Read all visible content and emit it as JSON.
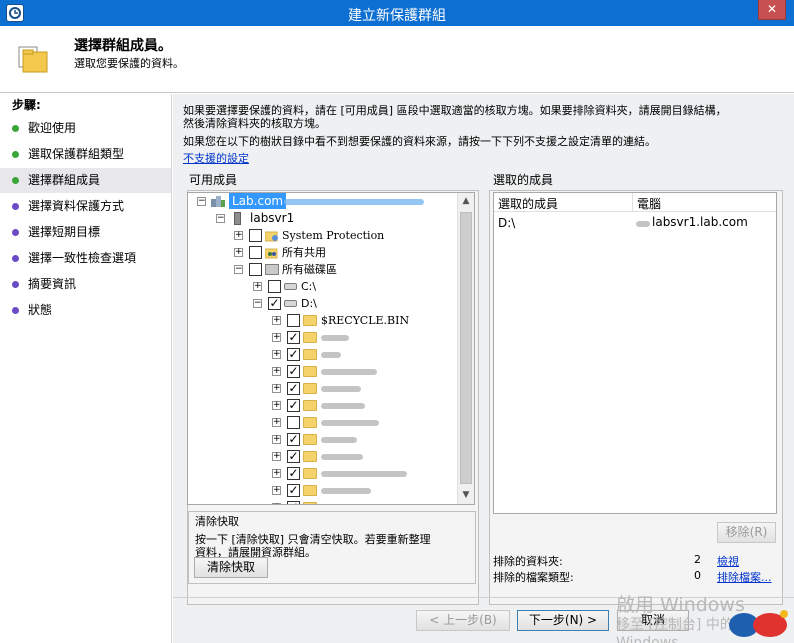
{
  "window": {
    "title": "建立新保護群組",
    "close": "✕"
  },
  "header": {
    "title": "選擇群組成員。",
    "subtitle": "選取您要保護的資料。"
  },
  "steps": {
    "title": "步驟:",
    "items": [
      {
        "label": "歡迎使用",
        "color": "#3aa63a"
      },
      {
        "label": "選取保護群組類型",
        "color": "#3aa63a"
      },
      {
        "label": "選擇群組成員",
        "color": "#3aa63a"
      },
      {
        "label": "選擇資料保護方式",
        "color": "#6a4bc4"
      },
      {
        "label": "選擇短期目標",
        "color": "#6a4bc4"
      },
      {
        "label": "選擇一致性檢查選項",
        "color": "#6a4bc4"
      },
      {
        "label": "摘要資訊",
        "color": "#6a4bc4"
      },
      {
        "label": "狀態",
        "color": "#6a4bc4"
      }
    ]
  },
  "intro": {
    "line1": "如果要選擇要保護的資料，請在 [可用成員] 區段中選取適當的核取方塊。如果要排除資料夾，請展開目錄結構，",
    "line2": "然後清除資料夾的核取方塊。",
    "line3": "如果您在以下的樹狀目錄中看不到想要保護的資料來源，請按一下下列不支援之設定清單的連結。",
    "unsupported_link": "不支援的設定"
  },
  "available": {
    "label": "可用成員",
    "tree": {
      "domain": "Lab.com",
      "server": "labsvr1",
      "system_protection": "System Protection",
      "all_shares": "所有共用",
      "all_volumes": "所有磁碟區",
      "drive_c": "C:\\",
      "drive_d": "D:\\",
      "recycle": "$RECYCLE.BIN",
      "folders": [
        {
          "checked": true
        },
        {
          "checked": true
        },
        {
          "checked": true
        },
        {
          "checked": true
        },
        {
          "checked": true
        },
        {
          "checked": false
        },
        {
          "checked": true
        },
        {
          "checked": true
        },
        {
          "checked": true
        },
        {
          "checked": true
        },
        {
          "checked": true
        }
      ]
    }
  },
  "cache": {
    "title": "清除快取",
    "desc1": "按一下 [清除快取] 只會清空快取。若要重新整理",
    "desc2": "資料，請展開資源群組。",
    "button": "清除快取"
  },
  "selected": {
    "label": "選取的成員",
    "columns": [
      "選取的成員",
      "電腦"
    ],
    "rows": [
      {
        "member": "D:\\",
        "computer": "labsvr1.lab.com"
      }
    ],
    "remove_button": "移除(R)",
    "excluded_folders_label": "排除的資料夾:",
    "excluded_folders_count": "2",
    "view_link": "檢視",
    "excluded_types_label": "排除的檔案類型:",
    "excluded_types_count": "0",
    "exclude_files_link": "排除檔案..."
  },
  "footer": {
    "back": "< 上一步(B)",
    "next": "下一步(N) >",
    "cancel": "取消"
  },
  "watermark": {
    "line1": "啟用 Windows",
    "line2": "移至 [控制台] 中的",
    "line3": "Windows。"
  }
}
